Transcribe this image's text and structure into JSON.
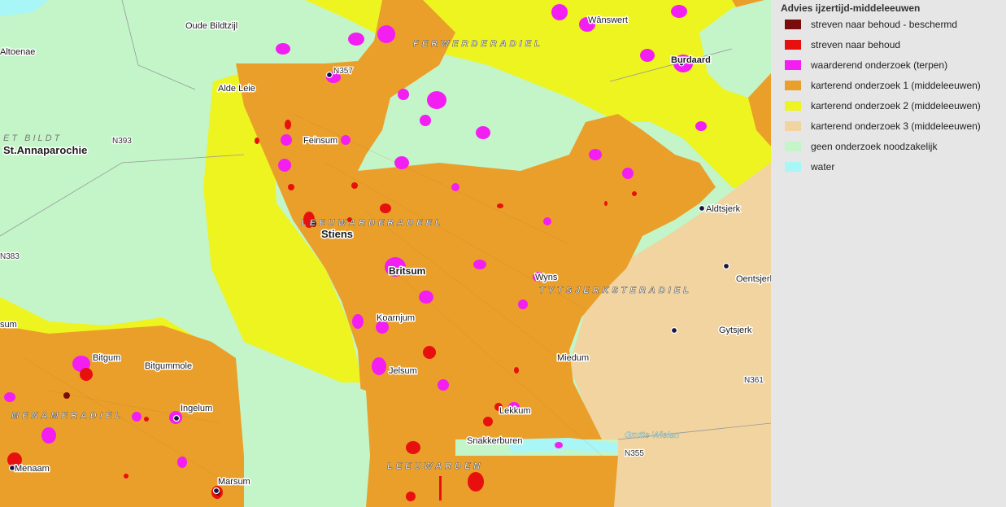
{
  "legend": {
    "title": "Advies ijzertijd-middeleeuwen",
    "items": [
      {
        "label": "streven naar behoud - beschermd",
        "color": "#7b0c0c"
      },
      {
        "label": "streven naar behoud",
        "color": "#e8100e"
      },
      {
        "label": "waarderend onderzoek (terpen)",
        "color": "#f21ef2"
      },
      {
        "label": "karterend onderzoek 1 (middeleeuwen)",
        "color": "#ea9f2a"
      },
      {
        "label": "karterend onderzoek 2 (middeleeuwen)",
        "color": "#eef41f"
      },
      {
        "label": "karterend onderzoek 3 (middeleeuwen)",
        "color": "#f1d4a0"
      },
      {
        "label": "geen onderzoek noodzakelijk",
        "color": "#c3f5c8"
      },
      {
        "label": "water",
        "color": "#a8f6f6"
      }
    ]
  },
  "places": {
    "oude_bildtzijl": "Oude Bildtzijl",
    "altoenae": "Altoenae",
    "wanswert": "Wânswert",
    "burdaard": "Burdaard",
    "alde_leie": "Alde Leie",
    "feinsum": "Feinsum",
    "st_annaparochie": "St.Annaparochie",
    "stiens": "Stiens",
    "aldtsjerk": "Aldtsjerk",
    "britsum": "Britsum",
    "wyns": "Wyns",
    "oentsjerk": "Oentsjerk",
    "koarnjum": "Koarnjum",
    "gytsjerk": "Gytsjerk",
    "bitgum": "Bitgum",
    "bitgummole": "Bitgummole",
    "jelsum": "Jelsum",
    "miedum": "Miedum",
    "ingelum": "Ingelum",
    "lekkum": "Lekkum",
    "snakkerburen": "Snakkerburen",
    "menaam": "Menaam",
    "marsum": "Marsum",
    "sum": "sum",
    "grutte_wielen": "Grutte Wielen"
  },
  "municipalities": {
    "ferwerderadiel": "FERWERDERADIEL",
    "leeuwarderadeel": "LEEUWARDERADEEL",
    "tytsjerksteradiel": "TYTSJERKSTERADIEL",
    "menameradiel": "MENAMERADIEL",
    "leeuwarden": "LEEUWARDEN",
    "het_bildt": "ET BILDT"
  },
  "roads": {
    "n357": "N357",
    "n393": "N393",
    "n383": "N383",
    "n361": "N361",
    "n355": "N355"
  }
}
